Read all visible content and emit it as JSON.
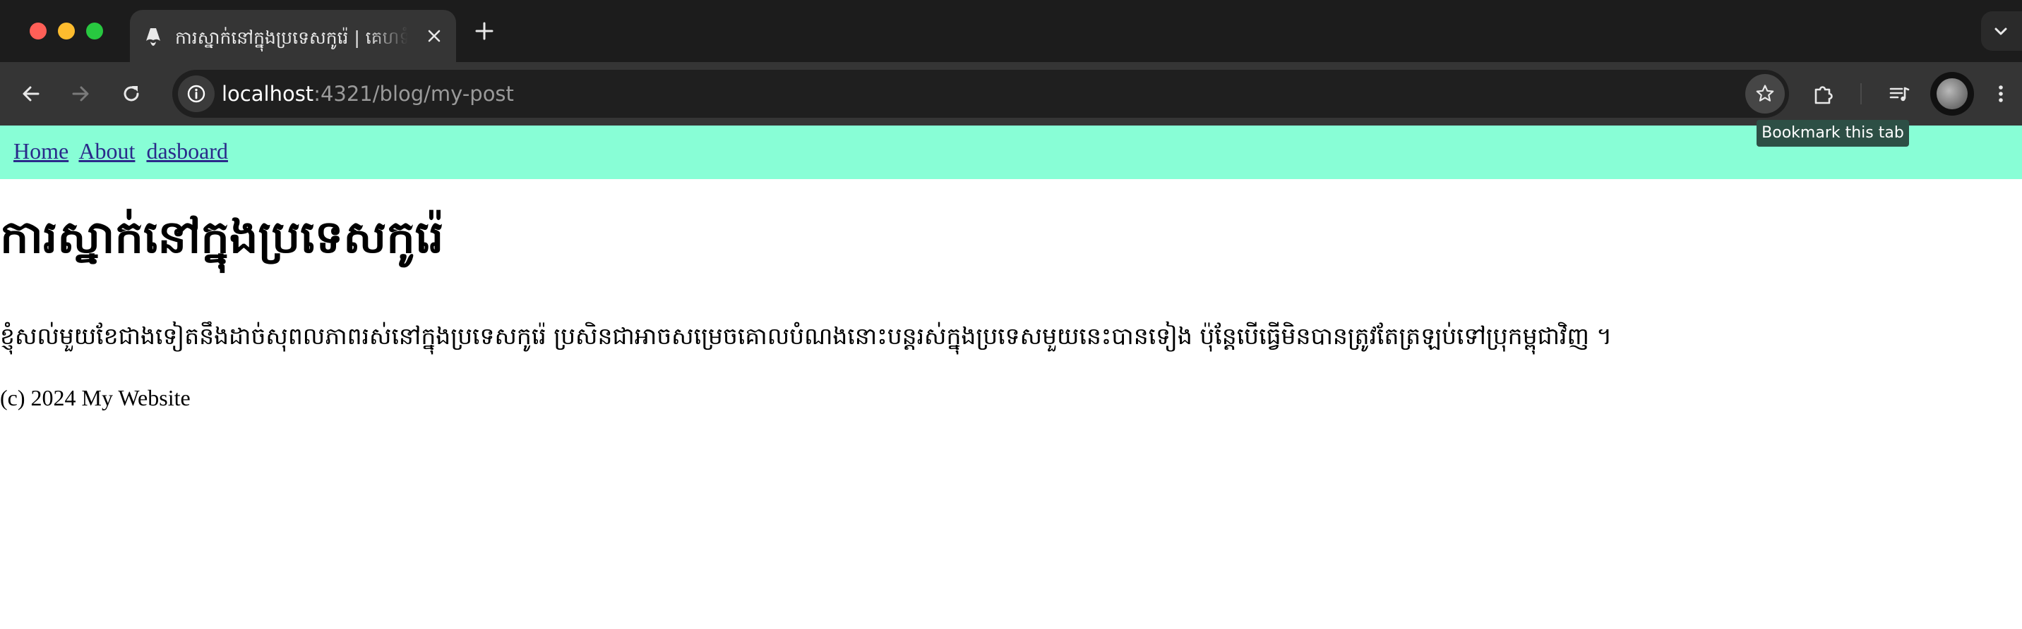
{
  "browser": {
    "tab": {
      "title": "ការស្នាក់នៅក្នុងប្រទេសកូរ៉េ | គេហទំព័រ"
    },
    "address_bar": {
      "host": "localhost",
      "path": ":4321/blog/my-post"
    },
    "tooltip": "Bookmark this tab",
    "icons": {
      "favicon": "astro-logo-icon",
      "close": "close-icon",
      "new_tab": "plus-icon",
      "tab_search": "chevron-down-icon",
      "back": "arrow-left-icon",
      "forward": "arrow-right-icon",
      "reload": "reload-icon",
      "site_info": "info-icon",
      "bookmark": "star-icon",
      "extensions": "puzzle-icon",
      "media": "media-control-icon",
      "profile": "avatar",
      "menu": "kebab-menu-icon"
    },
    "colors": {
      "traffic_red": "#ff5f57",
      "traffic_yellow": "#febc2e",
      "traffic_green": "#28c840"
    }
  },
  "page": {
    "nav": {
      "links": [
        "Home",
        "About",
        "dasboard"
      ],
      "background": "#88fed6"
    },
    "title": "ការស្នាក់នៅក្នុងប្រទេសកូរ៉េ",
    "body": "ខ្ញុំសល់មួយខែជាងទៀតនឹងដាច់សុពលភាពរស់នៅក្នុងប្រទេសកូរ៉េ ប្រសិនជាអាចសម្រេចគោលបំណងនោះបន្តរស់ក្នុងប្រទេសមួយនេះបានទៀង ប៉ុន្តែបើធ្វើមិនបានត្រូវតែត្រឡប់ទៅប្រុកម្ពុជាវិញ ។",
    "footer": "(c) 2024 My Website"
  }
}
